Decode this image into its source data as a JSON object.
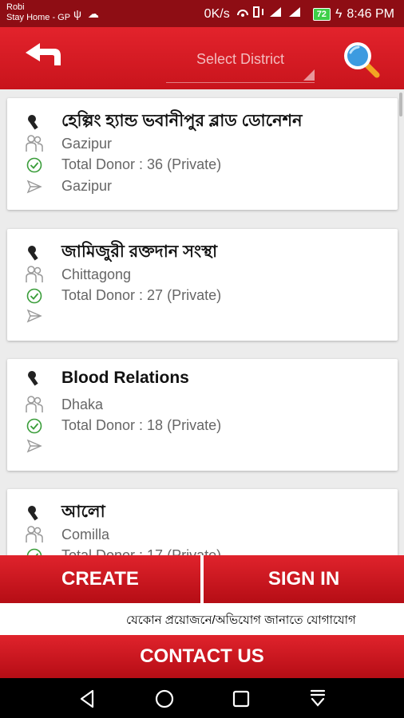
{
  "status_bar": {
    "carrier_line1": "Robi",
    "carrier_line2": "Stay Home - GP",
    "left_icons": "ψ ☁",
    "speed": "0K/s",
    "battery": "72",
    "time": "8:46 PM"
  },
  "app_bar": {
    "district_placeholder": "Select District"
  },
  "cards": [
    {
      "title": "হেল্পিং হ্যান্ড ভবানীপুর ব্লাড ডোনেশন",
      "location": "Gazipur",
      "donor": "Total Donor : 36 (Private)",
      "address": "Gazipur"
    },
    {
      "title": "জামিজুরী রক্তদান সংস্থা",
      "location": "Chittagong",
      "donor": "Total Donor : 27 (Private)",
      "address": ""
    },
    {
      "title": "Blood Relations",
      "location": "Dhaka",
      "donor": "Total Donor : 18 (Private)",
      "address": ""
    },
    {
      "title": "আলো",
      "location": "Comilla",
      "donor": "Total Donor : 17 (Private)",
      "address": ""
    }
  ],
  "buttons": {
    "create": "CREATE",
    "sign_in": "SIGN IN",
    "contact": "CONTACT US"
  },
  "marquee_text": "যেকোন প্রয়োজনে/অভিযোগ জানাতে  যোগাযোগ",
  "colors": {
    "primary": "#d81b24",
    "status_bar": "#8e0d14"
  }
}
